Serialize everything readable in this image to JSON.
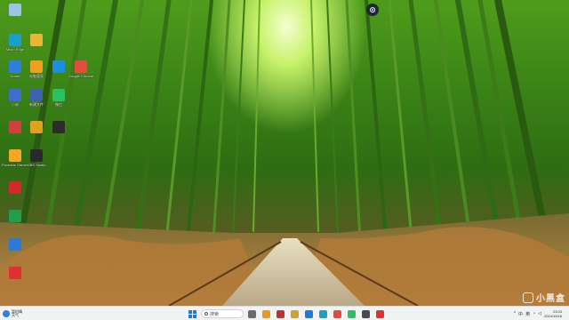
{
  "desktop": {
    "icons": [
      {
        "name": "recycle-bin-icon",
        "label": "",
        "color": "#9fc3e6"
      },
      {
        "name": "edge-icon",
        "label": "Micro Edge",
        "color": "#1aa0c8"
      },
      {
        "name": "folder-icon",
        "label": "",
        "color": "#e8b634"
      },
      {
        "name": "app-icon-1",
        "label": "Dorad",
        "color": "#2f7fdc"
      },
      {
        "name": "app-icon-2",
        "label": "电脑管家",
        "color": "#f0a020"
      },
      {
        "name": "app-icon-3",
        "label": "",
        "color": "#1a8fe0"
      },
      {
        "name": "chrome-icon",
        "label": "Google Chrome",
        "color": "#e44c3c"
      },
      {
        "name": "app-icon-4",
        "label": "小米",
        "color": "#3c6fd0"
      },
      {
        "name": "app-icon-5",
        "label": "新建文件",
        "color": "#4060b0"
      },
      {
        "name": "wechat-icon",
        "label": "微信",
        "color": "#2bc060"
      },
      {
        "name": "app-icon-6",
        "label": "",
        "color": "#d04040"
      },
      {
        "name": "app-icon-7",
        "label": "",
        "color": "#e0a020"
      },
      {
        "name": "app-icon-8",
        "label": "",
        "color": "#2c2c2c"
      },
      {
        "name": "rockstar-icon",
        "label": "Rockstar Games",
        "color": "#f5a623"
      },
      {
        "name": "obs-icon",
        "label": "OBS Studio",
        "color": "#2a2a2a"
      },
      {
        "name": "app-icon-9",
        "label": "",
        "color": "#d02a2a"
      },
      {
        "name": "app-icon-10",
        "label": "",
        "color": "#1f9e4c"
      },
      {
        "name": "app-icon-11",
        "label": "",
        "color": "#2a7ad6"
      },
      {
        "name": "app-icon-12",
        "label": "",
        "color": "#e03030"
      }
    ],
    "top_right_icon": {
      "name": "steam-icon",
      "label": ""
    }
  },
  "taskbar": {
    "weather": {
      "line1": "暂时晴",
      "line2": "天气"
    },
    "search_placeholder": "搜索",
    "clock_time": "23:03",
    "clock_date": "2024/10/16",
    "tray_lang": "中",
    "tray_glyph": "英",
    "apps": [
      {
        "name": "taskbar-app-1",
        "color": "#6b6b6b"
      },
      {
        "name": "taskbar-app-2",
        "color": "#e89a20"
      },
      {
        "name": "taskbar-app-3",
        "color": "#c03030"
      },
      {
        "name": "taskbar-app-4",
        "color": "#d0a030"
      },
      {
        "name": "taskbar-app-5",
        "color": "#1f7ae0"
      },
      {
        "name": "taskbar-app-6",
        "color": "#1aa0c8"
      },
      {
        "name": "taskbar-app-7",
        "color": "#e24a3a"
      },
      {
        "name": "taskbar-app-8",
        "color": "#2bc060"
      },
      {
        "name": "taskbar-app-9",
        "color": "#4a4a4a"
      },
      {
        "name": "taskbar-app-10",
        "color": "#e03030"
      }
    ]
  },
  "watermark": {
    "text": "小黑盒"
  }
}
